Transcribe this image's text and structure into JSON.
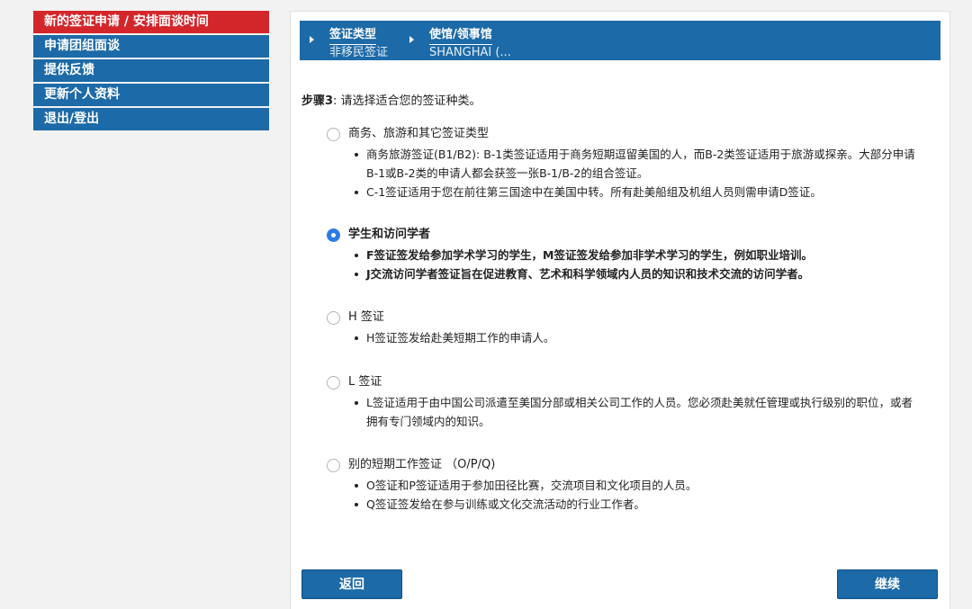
{
  "sidebar": {
    "items": [
      {
        "label": "新的签证申请 / 安排面谈时间",
        "active": true
      },
      {
        "label": "申请团组面谈"
      },
      {
        "label": "提供反馈"
      },
      {
        "label": "更新个人资料"
      },
      {
        "label": "退出/登出"
      }
    ]
  },
  "breadcrumb": {
    "visa_type": {
      "title": "签证类型",
      "value": "非移民签证"
    },
    "post": {
      "title": "使馆/领事馆",
      "value": "SHANGHAI (..."
    }
  },
  "step": {
    "number": "步骤3",
    "text": ": 请选择适合您的签证种类。"
  },
  "options": [
    {
      "label": "商务、旅游和其它签证类型",
      "selected": false,
      "bullets": [
        "商务旅游签证(B1/B2): B-1类签证适用于商务短期逗留美国的人，而B-2类签证适用于旅游或探亲。大部分申请B-1或B-2类的申请人都会获签一张B-1/B-2的组合签证。",
        "C-1签证适用于您在前往第三国途中在美国中转。所有赴美船组及机组人员则需申请D签证。"
      ]
    },
    {
      "label": "学生和访问学者",
      "selected": true,
      "bullets": [
        "F签证签发给参加学术学习的学生，M签证签发给参加非学术学习的学生，例如职业培训。",
        "J交流访问学者签证旨在促进教育、艺术和科学领域内人员的知识和技术交流的访问学者。"
      ]
    },
    {
      "label": "H 签证",
      "selected": false,
      "bullets": [
        "H签证签发给赴美短期工作的申请人。"
      ]
    },
    {
      "label": "L 签证",
      "selected": false,
      "bullets": [
        "L签证适用于由中国公司派遣至美国分部或相关公司工作的人员。您必须赴美就任管理或执行级别的职位，或者拥有专门领域内的知识。"
      ]
    },
    {
      "label": "别的短期工作签证 （O/P/Q)",
      "selected": false,
      "bullets": [
        "O签证和P签证适用于参加田径比赛，交流项目和文化项目的人员。",
        "Q签证签发给在参与训练或文化交流活动的行业工作者。"
      ]
    }
  ],
  "buttons": {
    "back": "返回",
    "continue": "继续"
  },
  "colors": {
    "primary_blue": "#1c6aa7",
    "active_red": "#d3262b",
    "radio_checked": "#2d7be8"
  }
}
